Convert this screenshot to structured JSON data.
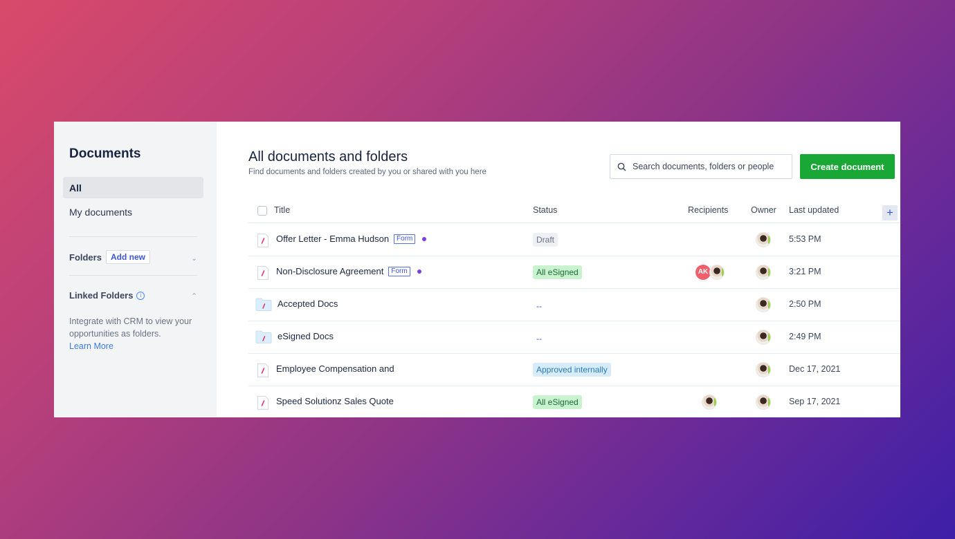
{
  "sidebar": {
    "title": "Documents",
    "items": [
      {
        "label": "All",
        "active": true
      },
      {
        "label": "My documents",
        "active": false
      }
    ],
    "folders": {
      "label": "Folders",
      "add_new": "Add new"
    },
    "linked_folders": {
      "label": "Linked Folders",
      "description": "Integrate with CRM to view your opportunities as folders.",
      "link": "Learn More"
    }
  },
  "header": {
    "title": "All documents and folders",
    "subtitle": "Find documents and folders created by you or shared with you here",
    "search_placeholder": "Search documents, folders or people",
    "create_button": "Create document"
  },
  "table": {
    "columns": {
      "title": "Title",
      "status": "Status",
      "recipients": "Recipients",
      "owner": "Owner",
      "last_updated": "Last updated"
    },
    "rows": [
      {
        "type": "document",
        "title": "Offer Letter - Emma Hudson",
        "badge": "Form",
        "dot": true,
        "status": "Draft",
        "status_kind": "draft",
        "recipients": [],
        "updated": "5:53 PM"
      },
      {
        "type": "document",
        "title": "Non-Disclosure Agreement",
        "badge": "Form",
        "dot": true,
        "status": "All eSigned",
        "status_kind": "signed",
        "recipients": [
          "AK",
          "photo"
        ],
        "updated": "3:21 PM"
      },
      {
        "type": "folder",
        "title": "Accepted Docs",
        "badge": "",
        "dot": false,
        "status": "--",
        "status_kind": "none",
        "recipients": [],
        "updated": "2:50 PM"
      },
      {
        "type": "folder",
        "title": "eSigned Docs",
        "badge": "",
        "dot": false,
        "status": "--",
        "status_kind": "none",
        "recipients": [],
        "updated": "2:49 PM"
      },
      {
        "type": "document",
        "title": "Employee Compensation and",
        "badge": "",
        "dot": false,
        "status": "Approved internally",
        "status_kind": "approved",
        "recipients": [],
        "updated": "Dec 17, 2021"
      },
      {
        "type": "document",
        "title": "Speed Solutionz Sales Quote",
        "badge": "",
        "dot": false,
        "status": "All eSigned",
        "status_kind": "signed",
        "recipients": [
          "photo"
        ],
        "updated": "Sep 17, 2021"
      }
    ]
  },
  "colors": {
    "accent": "#19a836",
    "link": "#3b55d9",
    "brand_slash": "#e8266e"
  }
}
